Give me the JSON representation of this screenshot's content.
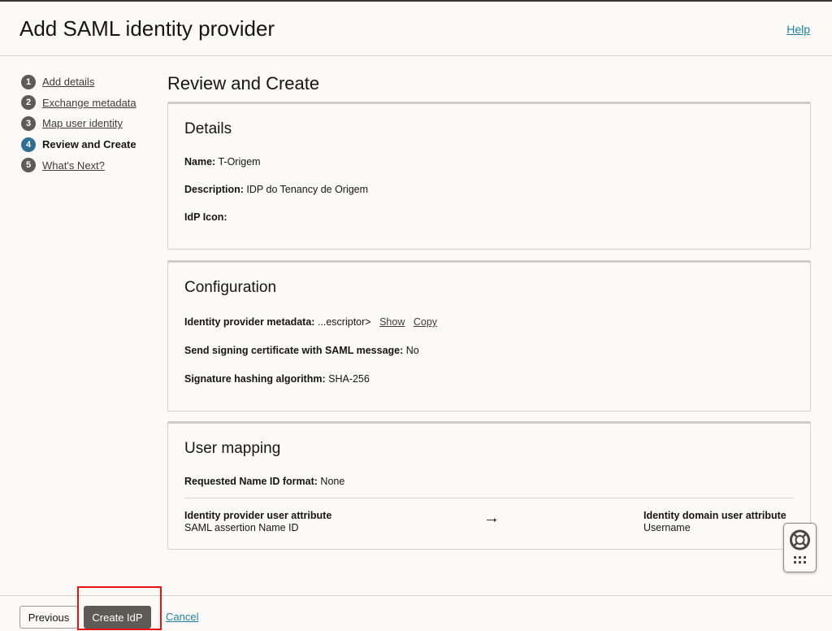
{
  "header": {
    "title": "Add SAML identity provider",
    "help_label": "Help"
  },
  "steps": [
    {
      "num": "1",
      "label": "Add details",
      "active": false
    },
    {
      "num": "2",
      "label": "Exchange metadata",
      "active": false
    },
    {
      "num": "3",
      "label": "Map user identity",
      "active": false
    },
    {
      "num": "4",
      "label": "Review and Create",
      "active": true
    },
    {
      "num": "5",
      "label": "What's Next?",
      "active": false
    }
  ],
  "main": {
    "title": "Review and Create"
  },
  "details": {
    "heading": "Details",
    "name_label": "Name:",
    "name_value": "T-Origem",
    "description_label": "Description:",
    "description_value": "IDP do Tenancy de Origem",
    "icon_label": "IdP Icon:"
  },
  "configuration": {
    "heading": "Configuration",
    "metadata_label": "Identity provider metadata:",
    "metadata_value": "...escriptor>",
    "show_label": "Show",
    "copy_label": "Copy",
    "signing_label": "Send signing certificate with SAML message:",
    "signing_value": "No",
    "hashing_label": "Signature hashing algorithm:",
    "hashing_value": "SHA-256"
  },
  "user_mapping": {
    "heading": "User mapping",
    "nameid_label": "Requested Name ID format:",
    "nameid_value": "None",
    "idp_attr_header": "Identity provider user attribute",
    "idp_attr_value": "SAML assertion Name ID",
    "arrow": "→",
    "domain_attr_header": "Identity domain user attribute",
    "domain_attr_value": "Username"
  },
  "footer": {
    "previous_label": "Previous",
    "create_label": "Create IdP",
    "cancel_label": "Cancel"
  },
  "icons": {
    "helper": "lifebuoy-icon",
    "helper_grid": "grid-icon"
  },
  "colors": {
    "accent": "#227e9e",
    "primary_button": "#5e5a55",
    "active_step": "#2f6f8f",
    "highlight": "#e8120f"
  }
}
